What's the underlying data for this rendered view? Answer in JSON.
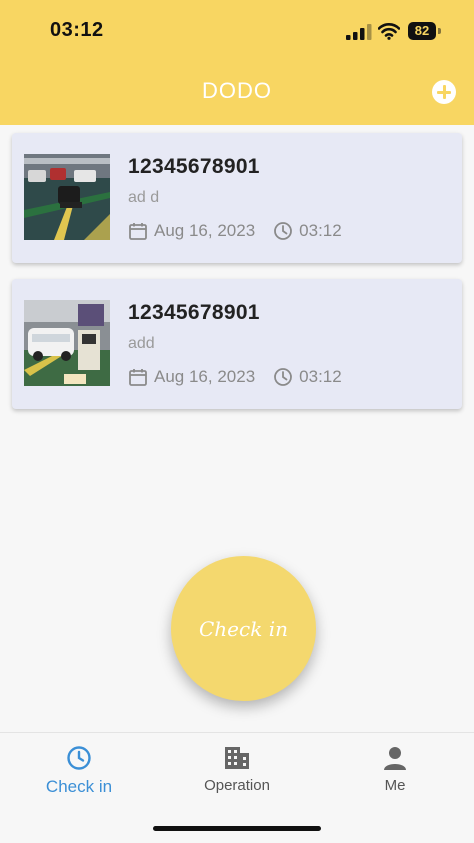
{
  "status_bar": {
    "time": "03:12",
    "battery": "82"
  },
  "header": {
    "title": "DODO",
    "add_icon": "plus-circle-icon"
  },
  "records": [
    {
      "phone": "12345678901",
      "note": "ad d",
      "date": "Aug 16, 2023",
      "time": "03:12",
      "thumbnail": "parking-garage-photo"
    },
    {
      "phone": "12345678901",
      "note": "add",
      "date": "Aug 16, 2023",
      "time": "03:12",
      "thumbnail": "parking-garage-photo"
    }
  ],
  "checkin_button": {
    "label": "Check in"
  },
  "bottom_nav": {
    "items": [
      {
        "label": "Check in",
        "icon": "clock-icon",
        "active": true
      },
      {
        "label": "Operation",
        "icon": "building-icon",
        "active": false
      },
      {
        "label": "Me",
        "icon": "person-icon",
        "active": false
      }
    ]
  },
  "colors": {
    "header_bg": "#f8d662",
    "card_bg": "#e7e9f5",
    "checkin_bg": "#f4d86e",
    "active_nav": "#3b8fd6"
  }
}
